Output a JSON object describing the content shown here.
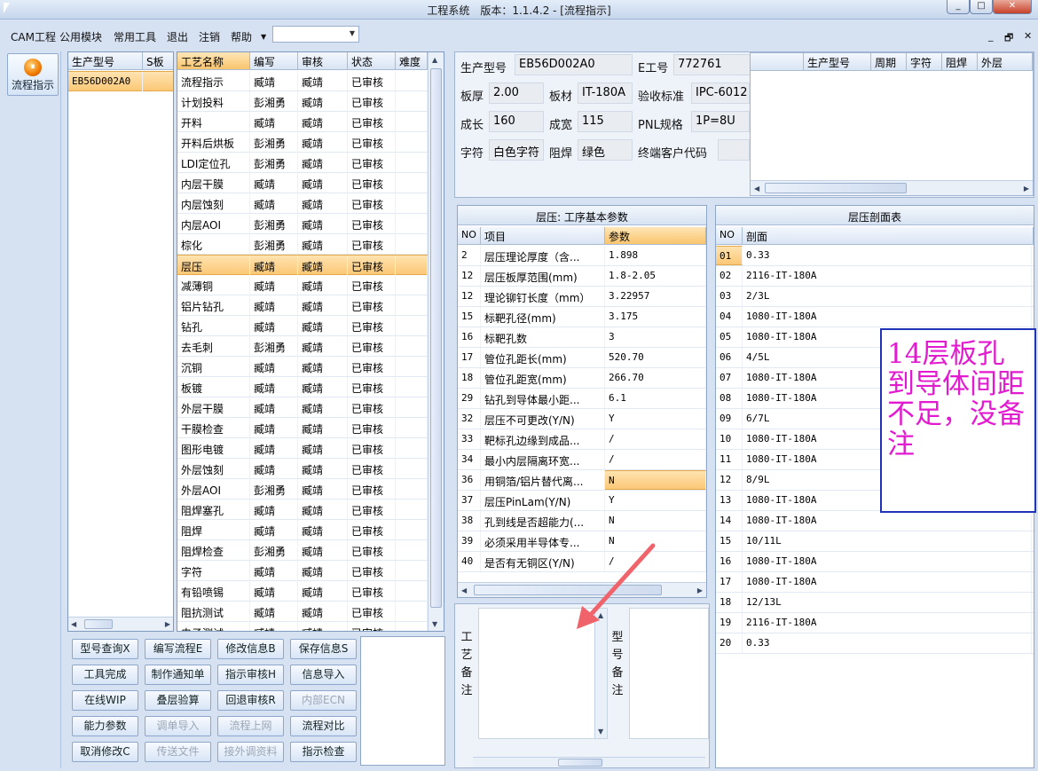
{
  "window": {
    "title": "工程系统　版本：1.1.4.2 - [流程指示]",
    "controls": [
      "_",
      "□",
      "✕"
    ]
  },
  "menubar": {
    "items": [
      "CAM工程",
      "公用模块",
      "常用工具",
      "退出",
      "注销",
      "帮助"
    ],
    "dropdown_value": "",
    "mdi_controls": [
      "_",
      "🗗",
      "✕"
    ]
  },
  "left_nav": {
    "flow_button_label": "流程指示"
  },
  "model_list": {
    "columns": [
      "生产型号",
      "S板"
    ],
    "rows": [
      [
        "EB56D002A0",
        ""
      ]
    ]
  },
  "process_list": {
    "columns": [
      "工艺名称",
      "编写",
      "审核",
      "状态",
      "难度"
    ],
    "rows": [
      [
        "流程指示",
        "臧靖",
        "臧靖",
        "已审核"
      ],
      [
        "计划投料",
        "彭湘勇",
        "臧靖",
        "已审核"
      ],
      [
        "开料",
        "臧靖",
        "臧靖",
        "已审核"
      ],
      [
        "开料后烘板",
        "彭湘勇",
        "臧靖",
        "已审核"
      ],
      [
        "LDI定位孔",
        "彭湘勇",
        "臧靖",
        "已审核"
      ],
      [
        "内层干膜",
        "臧靖",
        "臧靖",
        "已审核"
      ],
      [
        "内层蚀刻",
        "臧靖",
        "臧靖",
        "已审核"
      ],
      [
        "内层AOI",
        "彭湘勇",
        "臧靖",
        "已审核"
      ],
      [
        "棕化",
        "彭湘勇",
        "臧靖",
        "已审核"
      ],
      [
        "层压",
        "臧靖",
        "臧靖",
        "已审核"
      ],
      [
        "减薄铜",
        "臧靖",
        "臧靖",
        "已审核"
      ],
      [
        "铝片钻孔",
        "臧靖",
        "臧靖",
        "已审核"
      ],
      [
        "钻孔",
        "臧靖",
        "臧靖",
        "已审核"
      ],
      [
        "去毛刺",
        "彭湘勇",
        "臧靖",
        "已审核"
      ],
      [
        "沉铜",
        "臧靖",
        "臧靖",
        "已审核"
      ],
      [
        "板镀",
        "臧靖",
        "臧靖",
        "已审核"
      ],
      [
        "外层干膜",
        "臧靖",
        "臧靖",
        "已审核"
      ],
      [
        "干膜检查",
        "臧靖",
        "臧靖",
        "已审核"
      ],
      [
        "图形电镀",
        "臧靖",
        "臧靖",
        "已审核"
      ],
      [
        "外层蚀刻",
        "臧靖",
        "臧靖",
        "已审核"
      ],
      [
        "外层AOI",
        "彭湘勇",
        "臧靖",
        "已审核"
      ],
      [
        "阻焊塞孔",
        "臧靖",
        "臧靖",
        "已审核"
      ],
      [
        "阻焊",
        "臧靖",
        "臧靖",
        "已审核"
      ],
      [
        "阻焊检查",
        "彭湘勇",
        "臧靖",
        "已审核"
      ],
      [
        "字符",
        "臧靖",
        "臧靖",
        "已审核"
      ],
      [
        "有铅喷锡",
        "臧靖",
        "臧靖",
        "已审核"
      ],
      [
        "阻抗测试",
        "臧靖",
        "臧靖",
        "已审核"
      ],
      [
        "电子测试",
        "臧靖",
        "臧靖",
        "已审核"
      ]
    ],
    "selected_index": 9
  },
  "buttons": [
    [
      "型号查询X",
      "编写流程E",
      "修改信息B",
      "保存信息S"
    ],
    [
      "工具完成",
      "制作通知单",
      "指示审核H",
      "信息导入"
    ],
    [
      "在线WIP",
      "叠层验算",
      "回退审核R",
      "内部ECN"
    ],
    [
      "能力参数",
      "调单导入",
      "流程上网",
      "流程对比"
    ],
    [
      "取消修改C",
      "传送文件",
      "接外调资料",
      "指示检查"
    ]
  ],
  "disabled_buttons": [
    "内部ECN",
    "调单导入",
    "流程上网",
    "传送文件",
    "接外调资料"
  ],
  "info": {
    "model_label": "生产型号",
    "model_value": "EB56D002A0",
    "eno_label": "E工号",
    "eno_value": "772761",
    "thickness_label": "板厚",
    "thickness_value": "2.00",
    "material_label": "板材",
    "material_value": "IT-180A",
    "standard_label": "验收标准",
    "standard_value": "IPC-6012",
    "length_label": "成长",
    "length_value": "160",
    "width_label": "成宽",
    "width_value": "115",
    "pnl_label": "PNL规格",
    "pnl_value": "1P=8U",
    "char_label": "字符",
    "char_value": "白色字符",
    "mask_label": "阻焊",
    "mask_value": "绿色",
    "customer_label": "终端客户代码",
    "customer_value": ""
  },
  "right_table": {
    "columns": [
      "生产型号",
      "周期",
      "字符",
      "阻焊",
      "外层"
    ]
  },
  "params": {
    "title": "层压: 工序基本参数",
    "columns": [
      "NO",
      "项目",
      "参数"
    ],
    "rows": [
      [
        "2",
        "层压理论厚度（含...",
        "1.898"
      ],
      [
        "12",
        "层压板厚范围(mm)",
        "1.8-2.05"
      ],
      [
        "12",
        "理论铆钉长度（mm）",
        "3.22957"
      ],
      [
        "15",
        "标靶孔径(mm)",
        "3.175"
      ],
      [
        "16",
        "标靶孔数",
        "3"
      ],
      [
        "17",
        "管位孔距长(mm)",
        "520.70"
      ],
      [
        "18",
        "管位孔距宽(mm)",
        "266.70"
      ],
      [
        "29",
        "钻孔到导体最小距...",
        "6.1"
      ],
      [
        "32",
        "层压不可更改(Y/N)",
        "Y"
      ],
      [
        "33",
        "靶标孔边缘到成品...",
        "/"
      ],
      [
        "34",
        "最小内层隔离环宽...",
        "/"
      ],
      [
        "36",
        "用铜箔/铝片替代离...",
        "N"
      ],
      [
        "37",
        "层压PinLam(Y/N)",
        "Y"
      ],
      [
        "38",
        "孔到线是否超能力(...",
        "N"
      ],
      [
        "39",
        "必须采用半导体专...",
        "N"
      ],
      [
        "40",
        "是否有无铜区(Y/N)",
        "/"
      ]
    ],
    "selected_index": 11
  },
  "stackup": {
    "title": "层压剖面表",
    "columns": [
      "NO",
      "剖面"
    ],
    "rows": [
      [
        "01",
        "0.33"
      ],
      [
        "02",
        "2116-IT-180A"
      ],
      [
        "03",
        "2/3L"
      ],
      [
        "04",
        "1080-IT-180A"
      ],
      [
        "05",
        "1080-IT-180A"
      ],
      [
        "06",
        "4/5L"
      ],
      [
        "07",
        "1080-IT-180A"
      ],
      [
        "08",
        "1080-IT-180A"
      ],
      [
        "09",
        "6/7L"
      ],
      [
        "10",
        "1080-IT-180A"
      ],
      [
        "11",
        "1080-IT-180A"
      ],
      [
        "12",
        "8/9L"
      ],
      [
        "13",
        "1080-IT-180A"
      ],
      [
        "14",
        "1080-IT-180A"
      ],
      [
        "15",
        "10/11L"
      ],
      [
        "16",
        "1080-IT-180A"
      ],
      [
        "17",
        "1080-IT-180A"
      ],
      [
        "18",
        "12/13L"
      ],
      [
        "19",
        "2116-IT-180A"
      ],
      [
        "20",
        "0.33"
      ]
    ]
  },
  "remarks": {
    "process_label": "工艺备注",
    "model_label": "型号备注",
    "process_text": "",
    "model_text": ""
  },
  "annotation": {
    "text": "14层板孔到导体间距不足，没备注",
    "color": "#e31bd0",
    "border_color": "#1f33b8",
    "arrow_color": "#f0636b"
  }
}
